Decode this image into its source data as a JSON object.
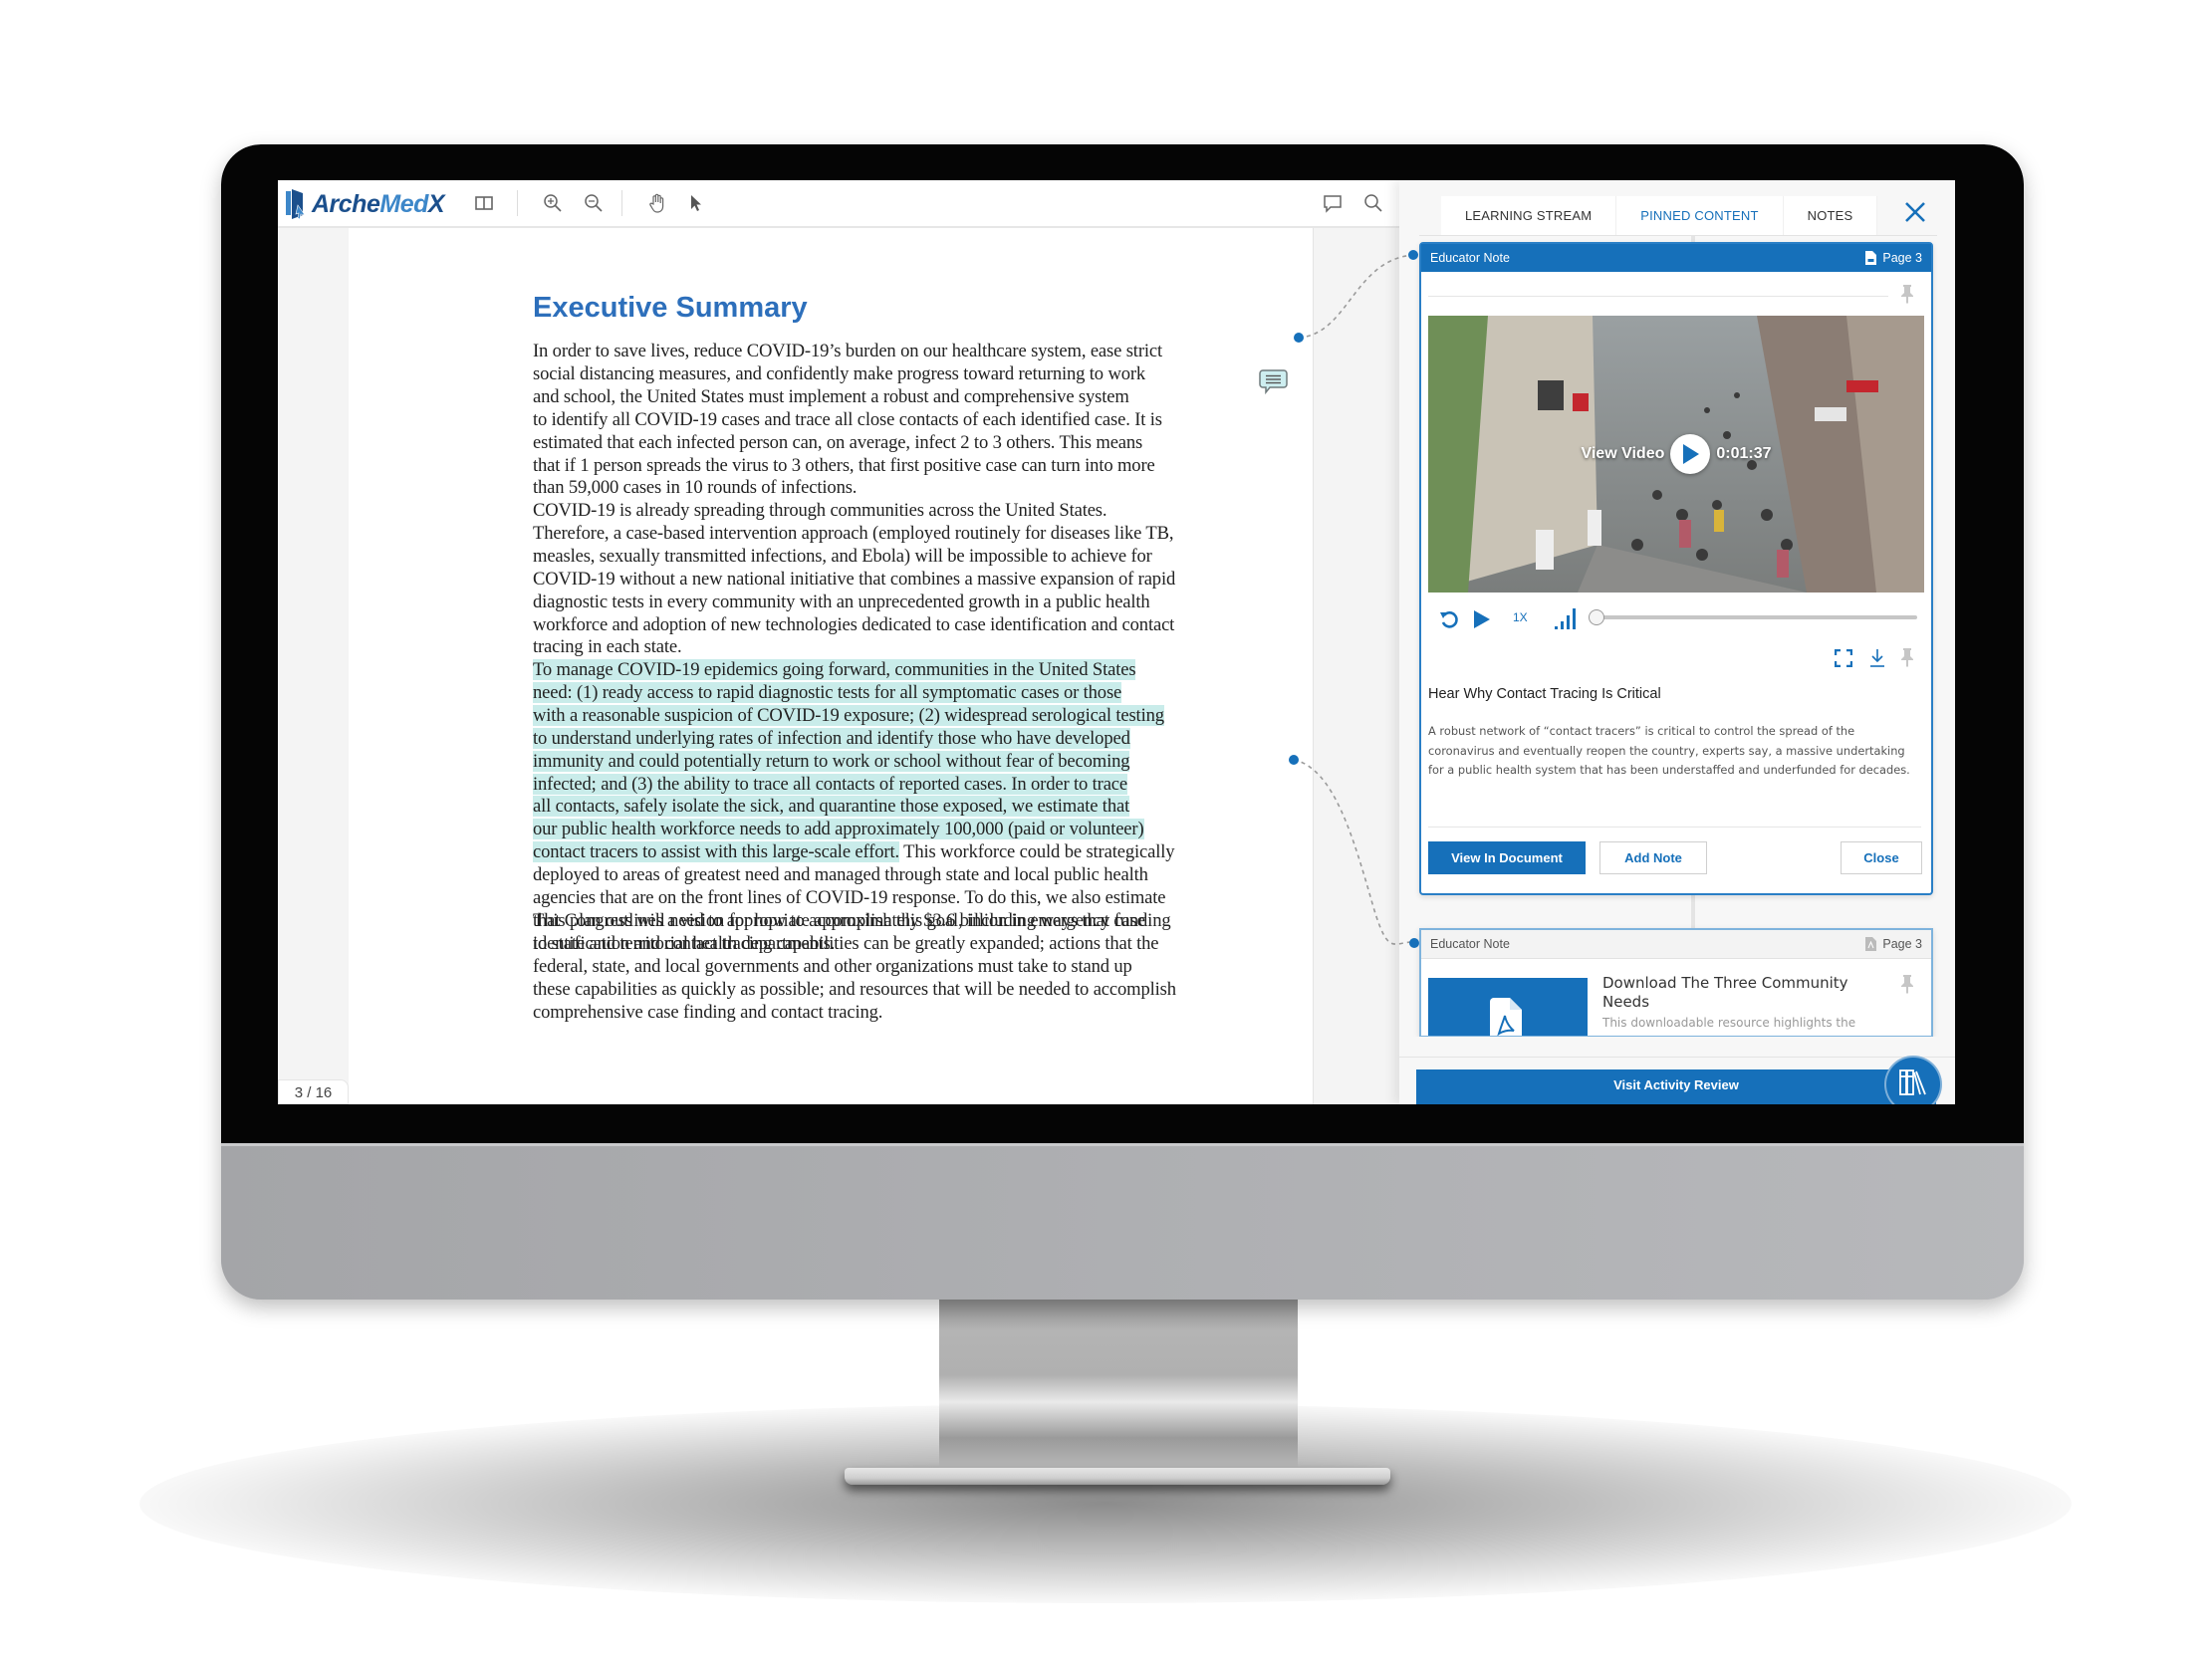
{
  "app": {
    "brand_parts": [
      "Arche",
      "Med",
      "X"
    ]
  },
  "toolbar": {
    "icons": [
      "sidebar-toggle-icon",
      "zoom-in-icon",
      "zoom-out-icon",
      "hand-tool-icon",
      "pointer-tool-icon",
      "comment-icon",
      "search-icon"
    ]
  },
  "document": {
    "title": "Executive Summary",
    "page_counter": "3 / 16",
    "paragraphs": [
      {
        "lines": [
          "In order to save lives, reduce COVID-19’s burden on our healthcare system, ease strict",
          "social distancing measures, and confidently make progress toward returning to work",
          "and school, the United States must implement a robust and comprehensive system",
          "to identify all COVID-19 cases and trace all close contacts of each identified case. It is",
          "estimated that each infected person can, on average, infect 2 to 3 others. This means",
          "that if 1 person spreads the virus to 3 others, that first positive case can turn into more",
          "than 59,000 cases in 10 rounds of infections."
        ]
      },
      {
        "lines": [
          "COVID-19 is already spreading through communities across the United States.",
          "Therefore, a case-based intervention approach (employed routinely for diseases like TB,",
          "measles, sexually transmitted infections, and Ebola) will be impossible to achieve for",
          "COVID-19 without a new national initiative that combines a massive expansion of rapid",
          "diagnostic tests in every community with an unprecedented growth in a public health",
          "workforce and adoption of new technologies dedicated to case identification and contact",
          "tracing in each state."
        ]
      },
      {
        "highlighted_lines": [
          "To manage COVID-19 epidemics going forward, communities in the United States",
          "need: (1) ready access to rapid diagnostic tests for all symptomatic cases or those",
          "with a reasonable suspicion of COVID-19 exposure; (2) widespread serological testing",
          "to understand underlying rates of infection and identify those who have developed",
          "immunity and could potentially return to work or school without fear of becoming",
          "infected; and (3) the ability to trace all contacts of reported cases. In order to trace",
          "all contacts, safely isolate the sick, and quarantine those exposed, we estimate that",
          "our public health workforce needs to add approximately 100,000 (paid or volunteer)",
          "contact tracers to assist with this large-scale effort."
        ],
        "tail_after_highlight": " This workforce could be strategically",
        "lines": [
          "deployed to areas of greatest need and managed through state and local public health",
          "agencies that are on the front lines of COVID-19 response. To do this, we also estimate",
          "that Congress will need to appropriate approximately $3.6 billion in emergency funding",
          "to state and territorial health departments."
        ]
      },
      {
        "lines": [
          "This plan outlines a vision for how to accomplish this goal, including ways that case",
          "identification and contact tracing capabilities can be greatly expanded; actions that the",
          "federal, state, and local governments and other organizations must take to stand up",
          "these capabilities as quickly as possible; and resources that will be needed to accomplish",
          "comprehensive case finding and contact tracing."
        ]
      }
    ]
  },
  "panel": {
    "tabs": [
      {
        "label": "LEARNING STREAM",
        "active": false
      },
      {
        "label": "PINNED CONTENT",
        "active": true
      },
      {
        "label": "NOTES",
        "active": false
      }
    ],
    "cards": [
      {
        "type_label": "Educator Note",
        "page_label": "Page 3",
        "video": {
          "label": "View Video",
          "duration": "0:01:37",
          "speed": "1X",
          "progress": 0.0
        },
        "title": "Hear Why Contact Tracing Is Critical",
        "description": "A robust network of “contact tracers” is critical to control the spread of the coronavirus and eventually reopen the country, experts say, a massive undertaking for a public health system that has been understaffed and underfunded for decades.",
        "buttons": {
          "view": "View In Document",
          "add_note": "Add Note",
          "close": "Close"
        }
      },
      {
        "type_label": "Educator Note",
        "page_label": "Page 3",
        "title": "Download The Three Community Needs",
        "description": "This downloadable resource highlights the"
      }
    ],
    "footer_button": "Visit Activity Review"
  },
  "colors": {
    "accent": "#1670ba",
    "title_blue": "#2d6fbb",
    "highlight": "#c9ecea",
    "logo_dark": "#1b4f8c",
    "logo_light": "#3d87c9"
  }
}
